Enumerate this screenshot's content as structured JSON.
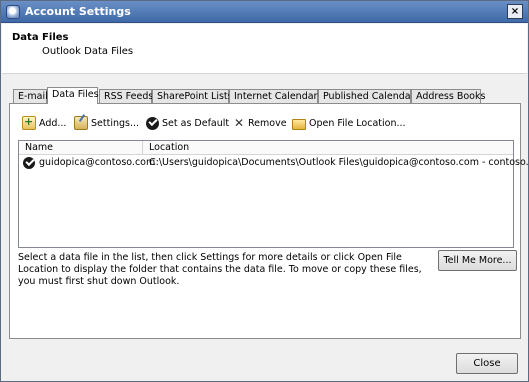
{
  "window": {
    "title": "Account Settings",
    "close_glyph": "×"
  },
  "header": {
    "title": "Data Files",
    "subtitle": "Outlook Data Files"
  },
  "tabs": [
    {
      "label": "E-mail"
    },
    {
      "label": "Data Files",
      "active": true
    },
    {
      "label": "RSS Feeds"
    },
    {
      "label": "SharePoint Lists"
    },
    {
      "label": "Internet Calendars"
    },
    {
      "label": "Published Calendars"
    },
    {
      "label": "Address Books"
    }
  ],
  "toolbar": {
    "add": "Add...",
    "settings": "Settings...",
    "set_default": "Set as Default",
    "remove": "Remove",
    "open_location": "Open File Location..."
  },
  "list": {
    "columns": [
      "Name",
      "Location"
    ],
    "rows": [
      {
        "name": "guidopica@contoso.com",
        "location": "C:\\Users\\guidopica\\Documents\\Outlook Files\\guidopica@contoso.com - contoso.pst",
        "default": true
      }
    ]
  },
  "help_text": "Select a data file in the list, then click Settings for more details or click Open File Location to display the folder that contains the data file. To move or copy these files, you must first shut down Outlook.",
  "buttons": {
    "tell_me_more": "Tell Me More...",
    "close": "Close"
  },
  "icons": {
    "app": "account-settings-icon",
    "add": "add-file-icon",
    "settings": "settings-icon",
    "default": "checkmark-icon",
    "remove": "x-remove-icon",
    "open": "folder-icon"
  },
  "colors": {
    "titlebar": "#4a76b5",
    "window_bg": "#f0f0f0"
  }
}
